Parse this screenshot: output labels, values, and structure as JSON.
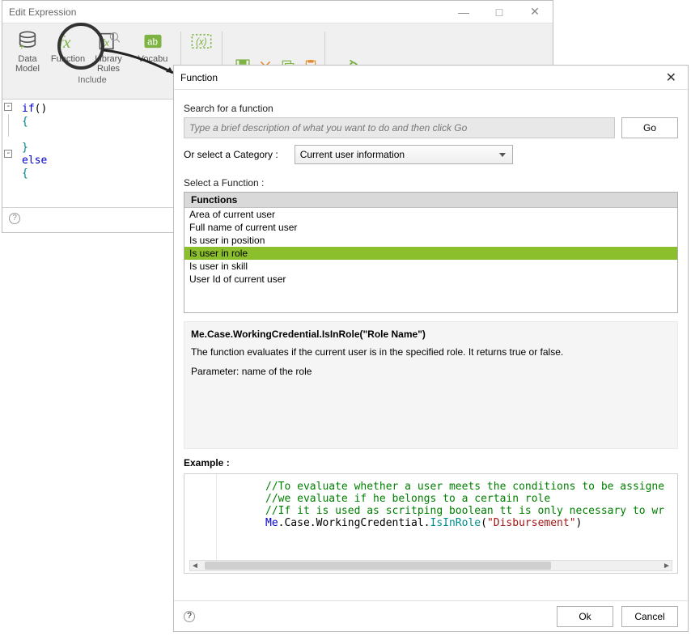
{
  "main_window": {
    "title": "Edit Expression",
    "ribbon": {
      "items": [
        {
          "label": "Data\nModel"
        },
        {
          "label": "Function"
        },
        {
          "label": "Library\nRules"
        },
        {
          "label": "Vocabu"
        }
      ],
      "group_label": "Include"
    },
    "code": {
      "line1_kw": "if",
      "line1_paren": "()",
      "brace_open": "{",
      "brace_close": "}",
      "line_else": "else"
    }
  },
  "dialog": {
    "title": "Function",
    "search_label": "Search for a function",
    "search_placeholder": "Type a brief description of what you want to do and then click Go",
    "go_label": "Go",
    "category_label": "Or select a Category :",
    "category_value": "Current user information",
    "select_fn_label": "Select a Function :",
    "functions_header": "Functions",
    "functions": [
      "Area of current user",
      "Full name of current user",
      "Is user in position",
      "Is user in role",
      "Is user in skill",
      "User Id of current user"
    ],
    "selected_index": 3,
    "signature": "Me.Case.WorkingCredential.IsInRole(\"Role Name\")",
    "description": "The function evaluates if the current user is in the specified role. It returns true or false.",
    "parameter": "Parameter: name of the role",
    "example_label": "Example :",
    "example": {
      "c1": "//To evaluate whether a user meets the conditions to be assigne",
      "c2": "//we evaluate if he belongs to a certain role",
      "c3": "//If it is used as scritping boolean tt is only necessary to wr",
      "code_me": "Me",
      "code_mid": ".Case.WorkingCredential.",
      "code_method": "IsInRole",
      "code_open": "(",
      "code_str": "\"Disbursement\"",
      "code_close": ")"
    },
    "ok_label": "Ok",
    "cancel_label": "Cancel"
  }
}
